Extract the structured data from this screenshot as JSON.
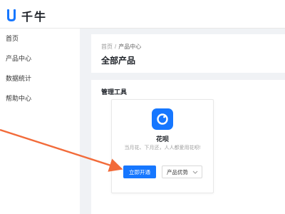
{
  "header": {
    "logo_text": "千牛",
    "logo_icon": "qianniu-logo-icon"
  },
  "sidebar": {
    "items": [
      {
        "label": "首页"
      },
      {
        "label": "产品中心"
      },
      {
        "label": "数据统计"
      },
      {
        "label": "帮助中心"
      }
    ]
  },
  "breadcrumb": {
    "home": "首页",
    "separator": "/",
    "current": "产品中心"
  },
  "page": {
    "title": "全部产品"
  },
  "section": {
    "title": "管理工具"
  },
  "card": {
    "icon": "huabei-icon",
    "name": "花呗",
    "description": "当月花、下月还，人人都爱用花呗!",
    "primary_button": "立即开通",
    "dropdown_label": "产品优势"
  },
  "colors": {
    "accent": "#1677ff",
    "annotation_arrow": "#f26b3a",
    "background": "#f0f2f5"
  }
}
